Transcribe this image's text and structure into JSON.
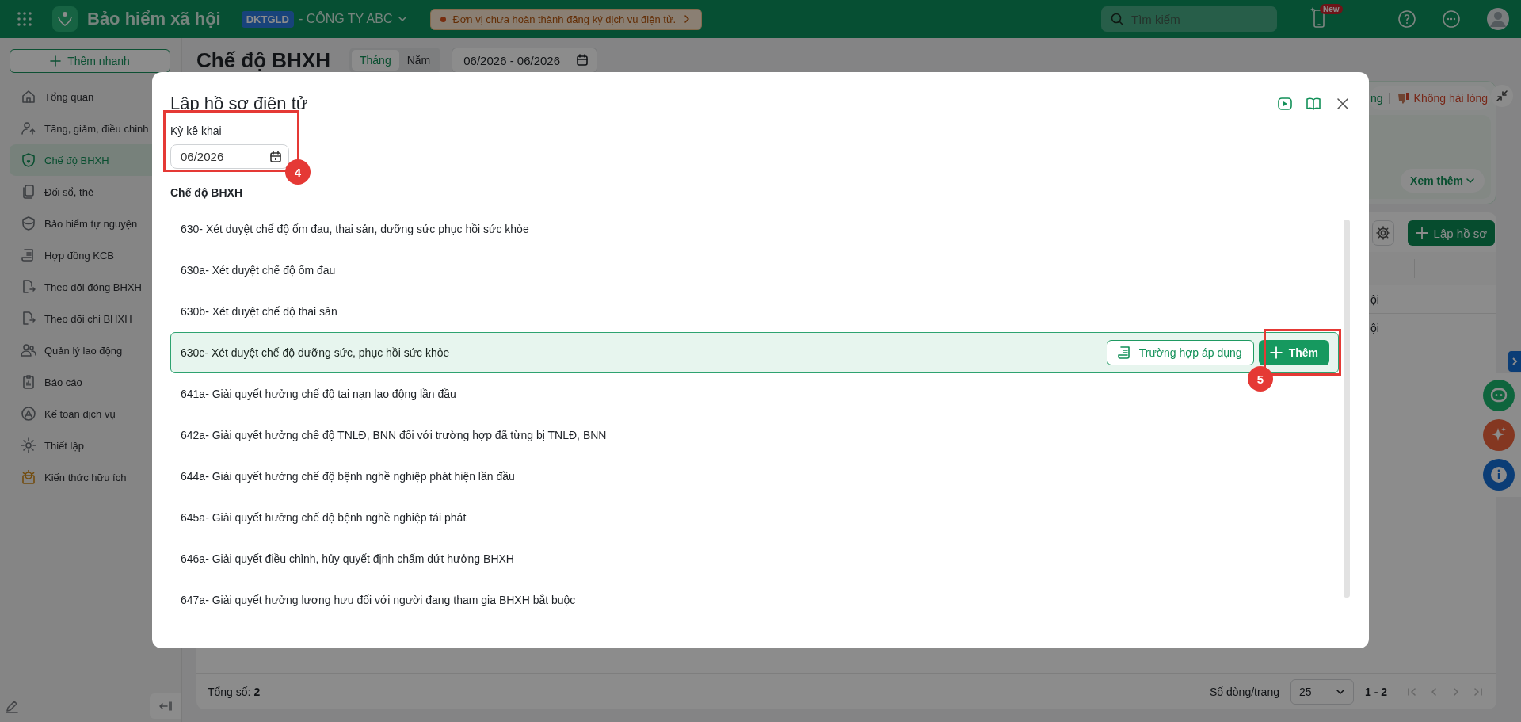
{
  "topbar": {
    "app_name": "Bảo hiểm xã hội",
    "org_badge": "DKTGLD",
    "company": "- CÔNG TY ABC",
    "notice": "Đơn vị chưa hoàn thành đăng ký dịch vụ điện tử.",
    "search": {
      "placeholder": "Tìm kiếm"
    },
    "new_badge": "New"
  },
  "sidebar": {
    "quick_add": "Thêm nhanh",
    "items": [
      {
        "label": "Tổng quan",
        "selected": false
      },
      {
        "label": "Tăng, giảm, điều chinh",
        "selected": false
      },
      {
        "label": "Chế độ BHXH",
        "selected": true
      },
      {
        "label": "Đối sổ, thẻ",
        "selected": false
      },
      {
        "label": "Bảo hiểm tự nguyện",
        "selected": false
      },
      {
        "label": "Hợp đồng KCB",
        "selected": false
      },
      {
        "label": "Theo dõi đóng BHXH",
        "selected": false
      },
      {
        "label": "Theo dõi chi BHXH",
        "selected": false
      },
      {
        "label": "Quản lý lao động",
        "selected": false
      },
      {
        "label": "Báo cáo",
        "selected": false
      },
      {
        "label": "Kế toán dịch vụ",
        "selected": false
      },
      {
        "label": "Thiết lập",
        "selected": false
      },
      {
        "label": "Kiến thức hữu ích",
        "selected": false
      }
    ]
  },
  "page": {
    "title": "Chế độ BHXH",
    "period_tabs": [
      {
        "label": "Tháng",
        "selected": true
      },
      {
        "label": "Năm",
        "selected": false
      }
    ],
    "date_range": "06/2026 - 06/2026",
    "feedback": {
      "positive": "ng",
      "negative": "Không hài lòng"
    },
    "see_more": "Xem thêm",
    "create_button": "Lập hồ sơ",
    "table": {
      "rows": [
        {
          "column_2": "ội"
        },
        {
          "column_2": "ội"
        }
      ]
    },
    "footer": {
      "total": "Tổng số: **2**",
      "rows_per_page_label": "Số dòng/trang",
      "rows_per_page": "25",
      "range": "1 - 2"
    }
  },
  "dialog": {
    "title": "Lập hồ sơ điện tử",
    "period": {
      "label": "Kỳ kê khai",
      "value": "06/2026"
    },
    "section_label": "Chế độ BHXH",
    "apply_cases_button": "Trường hợp áp dụng",
    "add_button": "Thêm",
    "regimes": [
      {
        "code": "630-",
        "title": "Xét duyệt chế độ ốm đau, thai sản, dưỡng sức phục hồi sức khỏe",
        "selected": false
      },
      {
        "code": "630a-",
        "title": "Xét duyệt chế độ ốm đau",
        "selected": false
      },
      {
        "code": "630b-",
        "title": "Xét duyệt chế độ thai sản",
        "selected": false
      },
      {
        "code": "630c-",
        "title": "Xét duyệt chế độ dưỡng sức, phục hồi sức khỏe",
        "selected": true
      },
      {
        "code": "641a-",
        "title": "Giải quyết hưởng chế độ tai nạn lao động lần đầu",
        "selected": false
      },
      {
        "code": "642a-",
        "title": "Giải quyết hưởng chế độ TNLĐ, BNN đối với trường hợp đã từng bị TNLĐ, BNN",
        "selected": false
      },
      {
        "code": "644a-",
        "title": "Giải quyết hưởng chế độ bệnh nghề nghiệp phát hiện lần đầu",
        "selected": false
      },
      {
        "code": "645a-",
        "title": "Giải quyết hưởng chế độ bệnh nghề nghiệp tái phát",
        "selected": false
      },
      {
        "code": "646a-",
        "title": "Giải quyết điều chỉnh, hủy quyết định chấm dứt hưởng BHXH",
        "selected": false
      },
      {
        "code": "647a-",
        "title": "Giải quyết hưởng lương hưu đối với người đang tham gia BHXH bắt buộc",
        "selected": false
      }
    ]
  },
  "annotations": [
    {
      "number": "4"
    },
    {
      "number": "5"
    }
  ]
}
